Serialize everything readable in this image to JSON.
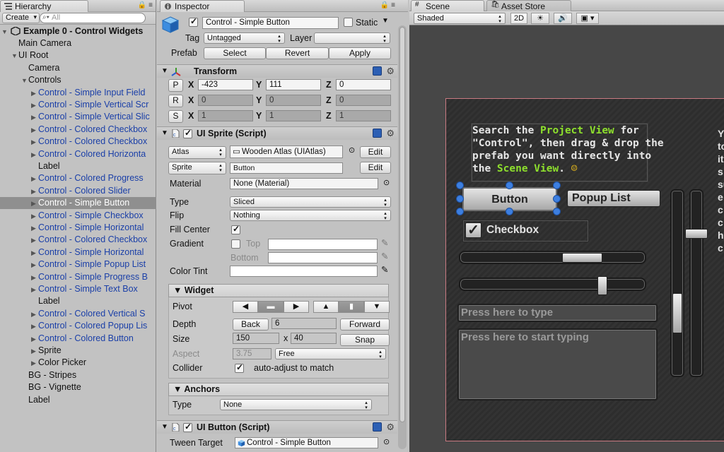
{
  "hierarchy": {
    "tab_label": "Hierarchy",
    "create_label": "Create",
    "search_placeholder": "All",
    "scene_root": "Example 0 - Control Widgets",
    "rows": [
      {
        "label": "Main Camera",
        "indent": 1,
        "arrow": "",
        "blue": false,
        "sel": false
      },
      {
        "label": "UI Root",
        "indent": 1,
        "arrow": "▼",
        "blue": false,
        "sel": false
      },
      {
        "label": "Camera",
        "indent": 2,
        "arrow": "",
        "blue": false,
        "sel": false
      },
      {
        "label": "Controls",
        "indent": 2,
        "arrow": "▼",
        "blue": false,
        "sel": false
      },
      {
        "label": "Control - Simple Input Field",
        "indent": 3,
        "arrow": "▶",
        "blue": true,
        "sel": false
      },
      {
        "label": "Control - Simple Vertical Scr",
        "indent": 3,
        "arrow": "▶",
        "blue": true,
        "sel": false
      },
      {
        "label": "Control - Simple Vertical Slic",
        "indent": 3,
        "arrow": "▶",
        "blue": true,
        "sel": false
      },
      {
        "label": "Control - Colored Checkbox",
        "indent": 3,
        "arrow": "▶",
        "blue": true,
        "sel": false
      },
      {
        "label": "Control - Colored Checkbox",
        "indent": 3,
        "arrow": "▶",
        "blue": true,
        "sel": false
      },
      {
        "label": "Control - Colored Horizonta",
        "indent": 3,
        "arrow": "▶",
        "blue": true,
        "sel": false
      },
      {
        "label": "Label",
        "indent": 3,
        "arrow": "",
        "blue": false,
        "sel": false
      },
      {
        "label": "Control - Colored Progress",
        "indent": 3,
        "arrow": "▶",
        "blue": true,
        "sel": false
      },
      {
        "label": "Control - Colored Slider",
        "indent": 3,
        "arrow": "▶",
        "blue": true,
        "sel": false
      },
      {
        "label": "Control - Simple Button",
        "indent": 3,
        "arrow": "▶",
        "blue": true,
        "sel": true
      },
      {
        "label": "Control - Simple Checkbox",
        "indent": 3,
        "arrow": "▶",
        "blue": true,
        "sel": false
      },
      {
        "label": "Control - Simple Horizontal",
        "indent": 3,
        "arrow": "▶",
        "blue": true,
        "sel": false
      },
      {
        "label": "Control - Colored Checkbox",
        "indent": 3,
        "arrow": "▶",
        "blue": true,
        "sel": false
      },
      {
        "label": "Control - Simple Horizontal",
        "indent": 3,
        "arrow": "▶",
        "blue": true,
        "sel": false
      },
      {
        "label": "Control - Simple Popup List",
        "indent": 3,
        "arrow": "▶",
        "blue": true,
        "sel": false
      },
      {
        "label": "Control - Simple Progress B",
        "indent": 3,
        "arrow": "▶",
        "blue": true,
        "sel": false
      },
      {
        "label": "Control - Simple Text Box",
        "indent": 3,
        "arrow": "▶",
        "blue": true,
        "sel": false
      },
      {
        "label": "Label",
        "indent": 3,
        "arrow": "",
        "blue": false,
        "sel": false
      },
      {
        "label": "Control - Colored Vertical S",
        "indent": 3,
        "arrow": "▶",
        "blue": true,
        "sel": false
      },
      {
        "label": "Control - Colored Popup Lis",
        "indent": 3,
        "arrow": "▶",
        "blue": true,
        "sel": false
      },
      {
        "label": "Control - Colored Button",
        "indent": 3,
        "arrow": "▶",
        "blue": true,
        "sel": false
      },
      {
        "label": "Sprite",
        "indent": 3,
        "arrow": "▶",
        "blue": false,
        "sel": false
      },
      {
        "label": "Color Picker",
        "indent": 3,
        "arrow": "▶",
        "blue": false,
        "sel": false
      },
      {
        "label": "BG - Stripes",
        "indent": 2,
        "arrow": "",
        "blue": false,
        "sel": false
      },
      {
        "label": "BG - Vignette",
        "indent": 2,
        "arrow": "",
        "blue": false,
        "sel": false
      },
      {
        "label": "Label",
        "indent": 2,
        "arrow": "",
        "blue": false,
        "sel": false
      }
    ]
  },
  "inspector": {
    "tab_label": "Inspector",
    "object_name": "Control - Simple Button",
    "static_label": "Static",
    "tag_label": "Tag",
    "tag_value": "Untagged",
    "layer_label": "Layer",
    "layer_value": "",
    "prefab_label": "Prefab",
    "prefab_select": "Select",
    "prefab_revert": "Revert",
    "prefab_apply": "Apply",
    "transform": {
      "title": "Transform",
      "p_btn": "P",
      "r_btn": "R",
      "s_btn": "S",
      "x": "X",
      "y": "Y",
      "z": "Z",
      "pos": [
        "-423",
        "111",
        "0"
      ],
      "rot": [
        "0",
        "0",
        "0"
      ],
      "scale": [
        "1",
        "1",
        "1"
      ]
    },
    "sprite": {
      "title": "UI Sprite (Script)",
      "atlas_btn": "Atlas",
      "atlas_value": "Wooden Atlas (UIAtlas)",
      "sprite_btn": "Sprite",
      "sprite_value": "Button",
      "edit_label": "Edit",
      "material_label": "Material",
      "material_value": "None (Material)",
      "type_label": "Type",
      "type_value": "Sliced",
      "flip_label": "Flip",
      "flip_value": "Nothing",
      "fill_center_label": "Fill Center",
      "gradient_label": "Gradient",
      "top_label": "Top",
      "bottom_label": "Bottom",
      "color_tint_label": "Color Tint"
    },
    "widget": {
      "title": "Widget",
      "pivot_label": "Pivot",
      "depth_label": "Depth",
      "depth_value": "6",
      "back_label": "Back",
      "forward_label": "Forward",
      "size_label": "Size",
      "width": "150",
      "x_sep": "x",
      "height": "40",
      "snap_label": "Snap",
      "aspect_label": "Aspect",
      "aspect_value": "3.75",
      "aspect_mode": "Free",
      "collider_label": "Collider",
      "collider_text": "auto-adjust to match"
    },
    "anchors": {
      "title": "Anchors",
      "type_label": "Type",
      "type_value": "None"
    },
    "button": {
      "title": "UI Button (Script)",
      "tween_label": "Tween Target",
      "tween_value": "Control - Simple Button"
    }
  },
  "scene": {
    "tab_label": "Scene",
    "asset_store_label": "Asset Store",
    "shading_mode": "Shaded",
    "mode_2d": "2D",
    "instructions": {
      "line1a": "Search the ",
      "line1b": "Project View",
      "line1c": " for",
      "line2": "\"Control\", then drag & drop the",
      "line3": "prefab you want directly into",
      "line4a": "the ",
      "line4b": "Scene View",
      "line4c": ". "
    },
    "button_label": "Button",
    "popup_label": "Popup List",
    "checkbox_label": "Checkbox",
    "slider1_value": 0.78,
    "slider2_value": 0.86,
    "input_placeholder": "Press here to type",
    "textbox_placeholder": "Press here to start typing",
    "right_edge_text": [
      "Y",
      "to",
      "it",
      "s",
      "su",
      "e",
      "c",
      "c",
      "h",
      "c"
    ]
  },
  "colors": {
    "accent_green": "#8ee02d",
    "selection_handle": "#3d7fe0",
    "hierarchy_link": "#1a3fa8"
  }
}
